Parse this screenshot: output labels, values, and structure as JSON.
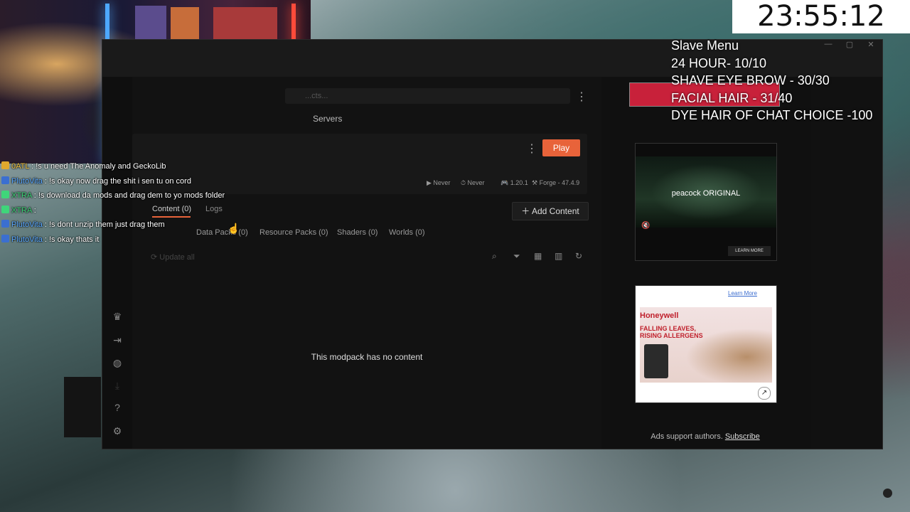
{
  "overlay": {
    "timer": "23:55:12",
    "menu": {
      "title": "Slave Menu",
      "items": [
        "24 HOUR- 10/10",
        "SHAVE EYE BROW - 30/30",
        "FACIAL HAIR - 31/40",
        "DYE HAIR OF CHAT CHOICE -100"
      ]
    }
  },
  "chat": {
    "messages": [
      {
        "name": "0ATL",
        "text": " : !s u need The Anomaly and GeckoLib"
      },
      {
        "name": "PlutoVita",
        "text": " : !s okay now drag the shit i sen tu on cord"
      },
      {
        "name": "XTRA",
        "text": " : !s download da mods and drag dem to yo mods folder"
      },
      {
        "name": "XTRA",
        "text": " :"
      },
      {
        "name": "PlutoVita",
        "text": " : !s dont unzip them just drag them"
      },
      {
        "name": "PlutoVita",
        "text": " : !s okay thats it"
      }
    ]
  },
  "app": {
    "search_placeholder": "...cts...",
    "tabs_top": {
      "servers": "Servers"
    },
    "play_label": "Play",
    "meta": {
      "last_played": "Never",
      "played_time": "Never",
      "game_version": "1.20.1",
      "loader": "Forge - 47.4.9"
    },
    "profile_tabs": {
      "content": "Content (0)",
      "logs": "Logs"
    },
    "add_content": "Add Content",
    "subtabs": {
      "data_packs": "Data Packs (0)",
      "resource_packs": "Resource Packs (0)",
      "shaders": "Shaders (0)",
      "worlds": "Worlds (0)"
    },
    "update_all": "Update all",
    "empty_message": "This modpack has no content"
  },
  "ads": {
    "ad1": {
      "title": "peacock ORIGINAL",
      "cta": "LEARN MORE"
    },
    "ad2": {
      "cta": "Learn More",
      "brand": "Honeywell",
      "headline": "FALLING LEAVES,\nRISING ALLERGENS"
    },
    "support": {
      "text": "Ads support authors.",
      "link": "Subscribe"
    }
  }
}
